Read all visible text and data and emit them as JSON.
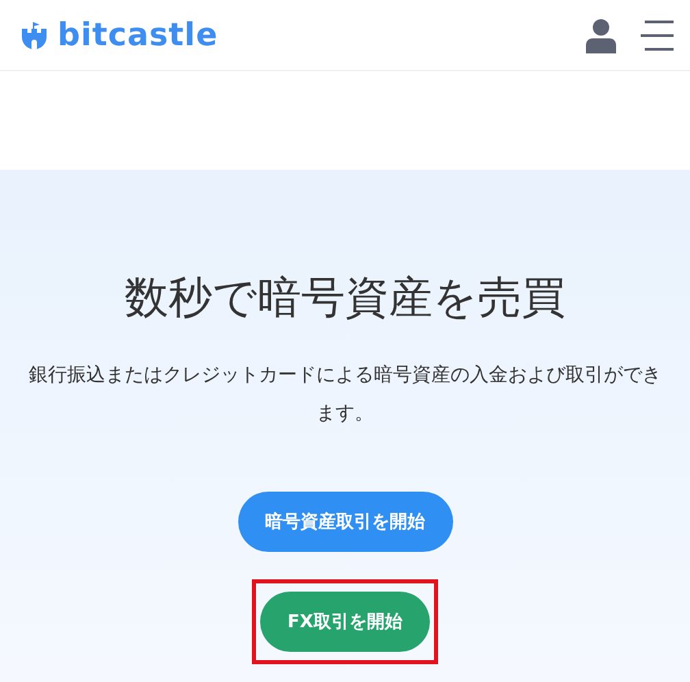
{
  "header": {
    "logo": "bitcastle"
  },
  "hero": {
    "title": "数秒で暗号資産を売買",
    "description": "銀行振込またはクレジットカードによる暗号資産の入金および取引ができます。",
    "buttons": [
      {
        "label": "暗号資産取引を開始",
        "kind": "primary",
        "highlighted": false
      },
      {
        "label": "FX取引を開始",
        "kind": "success",
        "highlighted": true
      }
    ]
  }
}
